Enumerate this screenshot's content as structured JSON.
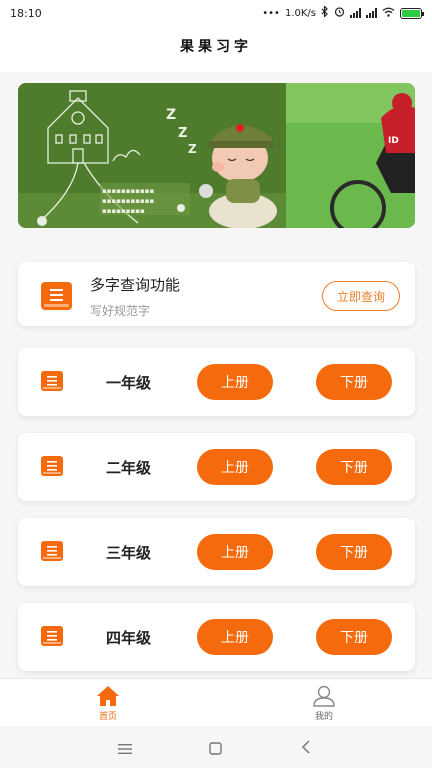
{
  "status_bar": {
    "time": "18:10",
    "net_speed": "1.0K/s",
    "battery_level": 1.0
  },
  "header": {
    "title": "果果习字"
  },
  "banner": {
    "slide_left": "cartoon-classroom-chalkboard",
    "slide_right": "cyclist-photo"
  },
  "feature": {
    "title": "多字查询功能",
    "subtitle": "写好规范字",
    "button_label": "立即查询",
    "icon": "book-icon"
  },
  "grades": [
    {
      "name": "一年级",
      "vol_up": "上册",
      "vol_down": "下册"
    },
    {
      "name": "二年级",
      "vol_up": "上册",
      "vol_down": "下册"
    },
    {
      "name": "三年级",
      "vol_up": "上册",
      "vol_down": "下册"
    },
    {
      "name": "四年级",
      "vol_up": "上册",
      "vol_down": "下册"
    }
  ],
  "bottom_nav": {
    "home_label": "首页",
    "mine_label": "我的",
    "active": "home"
  },
  "colors": {
    "accent": "#f56a0c",
    "outline_accent": "#f07f2a",
    "nav_active": "#f56a0c",
    "nav_inactive": "#888888"
  }
}
